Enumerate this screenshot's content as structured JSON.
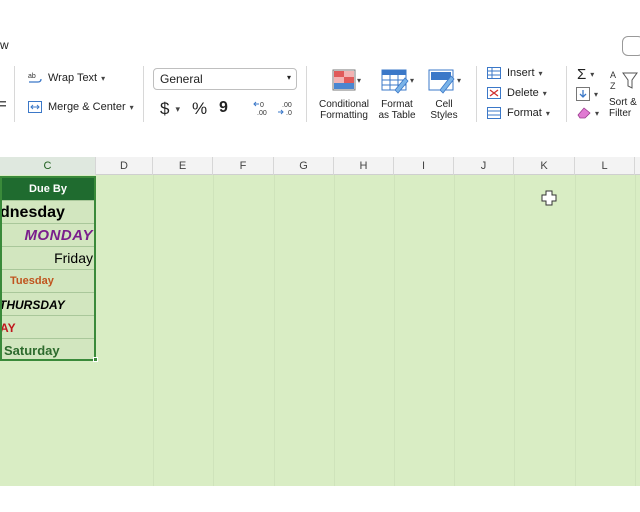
{
  "window": {
    "menu_fragment": "w"
  },
  "ribbon": {
    "wrap_text": "Wrap Text",
    "merge_center": "Merge & Center",
    "number_format": "General",
    "currency_symbol": "$",
    "percent_symbol": "%",
    "comma_symbol": "9",
    "conditional_formatting": [
      "Conditional",
      "Formatting"
    ],
    "format_as_table": [
      "Format",
      "as Table"
    ],
    "cell_styles": [
      "Cell",
      "Styles"
    ],
    "insert": "Insert",
    "delete": "Delete",
    "format": "Format",
    "sort_filter": [
      "Sort &",
      "Filter"
    ]
  },
  "columns": [
    "C",
    "D",
    "E",
    "F",
    "G",
    "H",
    "I",
    "J",
    "K",
    "L"
  ],
  "table": {
    "header": "Due By",
    "rows": [
      {
        "text": "dnesday",
        "color": "#000000"
      },
      {
        "text": "MONDAY",
        "color": "#7a1f8c"
      },
      {
        "text": "Friday",
        "color": "#000000"
      },
      {
        "text": "Tuesday",
        "color": "#c0541e"
      },
      {
        "text": "THURSDAY",
        "color": "#000000"
      },
      {
        "text": "AY",
        "color": "#c0161d"
      },
      {
        "text": "Saturday",
        "color": "#2d6a2d"
      }
    ],
    "header_bg": "#1f6b2f"
  },
  "colors": {
    "sheet_bg": "#d9edc4",
    "selection": "#3a8a3a"
  }
}
